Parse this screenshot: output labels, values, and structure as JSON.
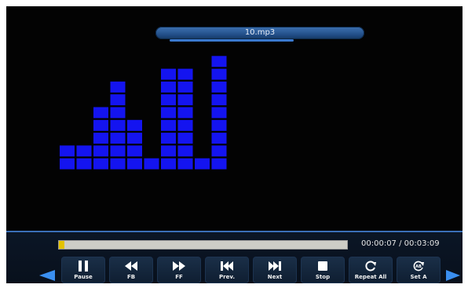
{
  "player": {
    "file_name": "10.mp3",
    "time_display": "00:00:07 / 00:03:09",
    "progress": 0.02,
    "colors": {
      "background": "#030303",
      "spectrum": "#1414f0",
      "progress_fill": "#e4c300",
      "progress_track": "#cdcdc6",
      "active_border": "#2f86e8"
    }
  },
  "spectrum": {
    "levels": [
      2,
      2,
      5,
      7,
      4,
      1,
      8,
      8,
      1,
      9
    ]
  },
  "controls": [
    {
      "label": "Pause",
      "icon": "pause-icon",
      "active": true
    },
    {
      "label": "FB",
      "icon": "fast-backward-icon",
      "active": false
    },
    {
      "label": "FF",
      "icon": "fast-forward-icon",
      "active": false
    },
    {
      "label": "Prev.",
      "icon": "skip-previous-icon",
      "active": false
    },
    {
      "label": "Next",
      "icon": "skip-next-icon",
      "active": false
    },
    {
      "label": "Stop",
      "icon": "stop-icon",
      "active": false
    },
    {
      "label": "Repeat All",
      "icon": "repeat-icon",
      "active": false
    },
    {
      "label": "Set A",
      "icon": "ab-repeat-icon",
      "active": false
    }
  ]
}
